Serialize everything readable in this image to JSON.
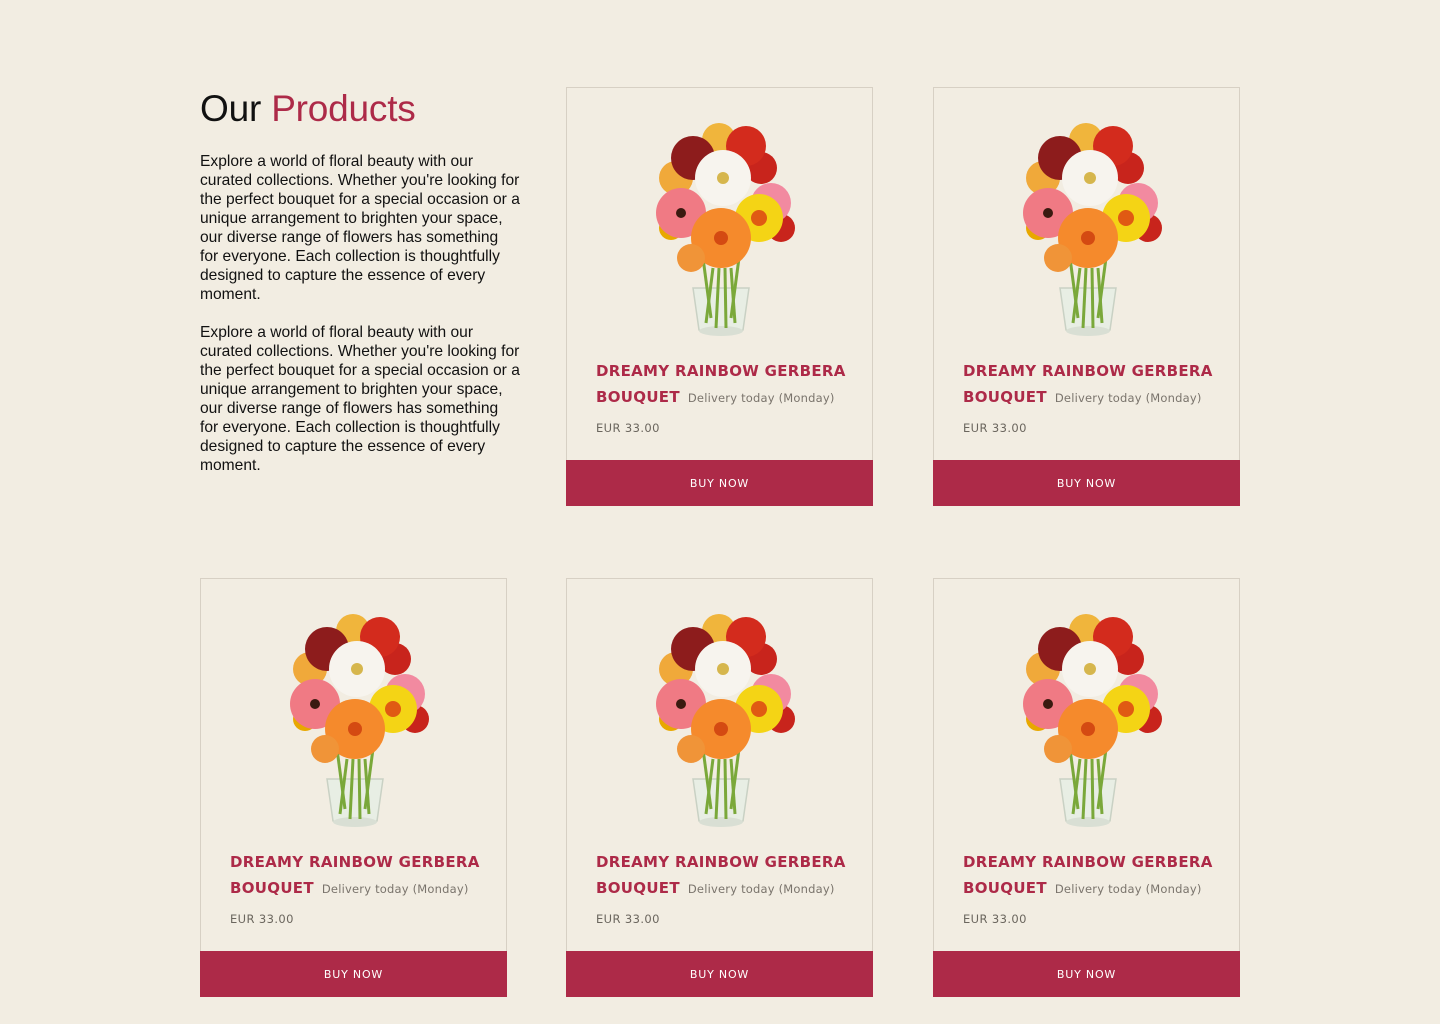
{
  "section": {
    "title_part1": "Our",
    "title_part2": "Products",
    "paragraphs": [
      "Explore a world of floral beauty with our curated collections. Whether you're looking for the perfect bouquet for a special occasion or a unique arrangement to brighten your space, our diverse range of flowers has something for everyone. Each collection is thoughtfully designed to capture the essence of every moment.",
      "Explore a world of floral beauty with our curated collections. Whether you're looking for the perfect bouquet for a special occasion or a unique arrangement to brighten your space, our diverse range of flowers has something for everyone. Each collection is thoughtfully designed to capture the essence of every moment."
    ]
  },
  "products": [
    {
      "name": "DREAMY RAINBOW GERBERA BOUQUET",
      "delivery": "Delivery today (Monday)",
      "price": "EUR 33.00",
      "button": "BUY NOW",
      "image_icon": "gerbera-bouquet-icon"
    },
    {
      "name": "DREAMY RAINBOW GERBERA BOUQUET",
      "delivery": "Delivery today (Monday)",
      "price": "EUR 33.00",
      "button": "BUY NOW",
      "image_icon": "gerbera-bouquet-icon"
    },
    {
      "name": "DREAMY RAINBOW GERBERA BOUQUET",
      "delivery": "Delivery today (Monday)",
      "price": "EUR 33.00",
      "button": "BUY NOW",
      "image_icon": "gerbera-bouquet-icon"
    },
    {
      "name": "DREAMY RAINBOW GERBERA BOUQUET",
      "delivery": "Delivery today (Monday)",
      "price": "EUR 33.00",
      "button": "BUY NOW",
      "image_icon": "gerbera-bouquet-icon"
    },
    {
      "name": "DREAMY RAINBOW GERBERA BOUQUET",
      "delivery": "Delivery today (Monday)",
      "price": "EUR 33.00",
      "button": "BUY NOW",
      "image_icon": "gerbera-bouquet-icon"
    }
  ],
  "colors": {
    "background": "#f2ede2",
    "accent": "#ad2a48",
    "text": "#111111",
    "muted": "#7a746c"
  }
}
